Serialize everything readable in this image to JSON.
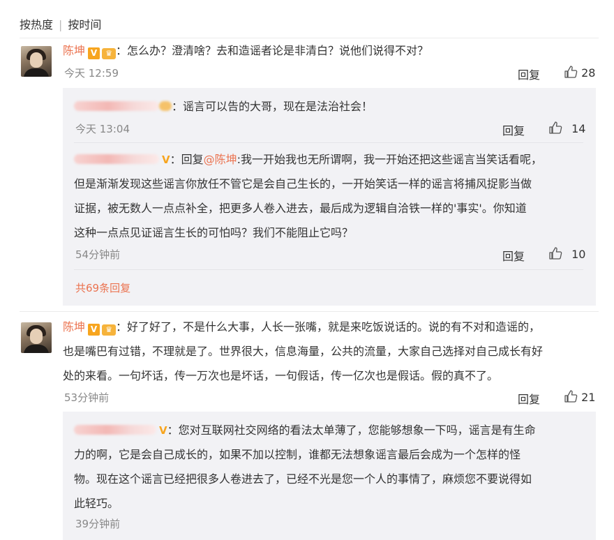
{
  "sort": {
    "hot": "按热度",
    "separator": "|",
    "time": "按时间"
  },
  "thread1": {
    "user": "陈坤",
    "v_badge": "V",
    "text": "：怎么办？澄清啥？去和造谣者论是非清白？说他们说得不对？",
    "time": "今天 12:59",
    "reply_label": "回复",
    "likes": "28",
    "replies": [
      {
        "text": "：谣言可以告的大哥，现在是法治社会！",
        "time": "今天 13:04",
        "reply_label": "回复",
        "likes": "14"
      },
      {
        "v_badge": "V",
        "prefix": "：回复",
        "mention": "@陈坤",
        "lines": [
          ":我一开始我也无所谓啊，我一开始还把这些谣言当笑话看呢，",
          "但是渐渐发现这些谣言你放任不管它是会自己生长的，一开始笑话一样的谣言将捕风捉影当做",
          "证据，被无数人一点点补全，把更多人卷入进去，最后成为逻辑自洽铁一样的'事实'。你知道",
          "这种一点点见证谣言生长的可怕吗？我们不能阻止它吗？"
        ],
        "time": "54分钟前",
        "reply_label": "回复",
        "likes": "10"
      }
    ],
    "more_replies": "共69条回复"
  },
  "thread2": {
    "user": "陈坤",
    "v_badge": "V",
    "lines": [
      "：好了好了，不是什么大事，人长一张嘴，就是来吃饭说话的。说的有不对和造谣的，",
      "也是嘴巴有过错，不理就是了。世界很大，信息海量，公共的流量，大家自己选择对自己成长有好",
      "处的来看。一句坏话，传一万次也是坏话，一句假话，传一亿次也是假话。假的真不了。"
    ],
    "time": "53分钟前",
    "reply_label": "回复",
    "likes": "21",
    "replies": [
      {
        "v_badge": "V",
        "lines": [
          "：您对互联网社交网络的看法太单薄了，您能够想象一下吗，谣言是有生命",
          "力的啊，它是会自己成长的，如果不加以控制，谁都无法想象谣言最后会成为一个怎样的怪",
          "物。现在这个谣言已经把很多人卷进去了，已经不光是您一个人的事情了，麻烦您不要说得如",
          "此轻巧。"
        ],
        "time": "39分钟前"
      }
    ]
  }
}
